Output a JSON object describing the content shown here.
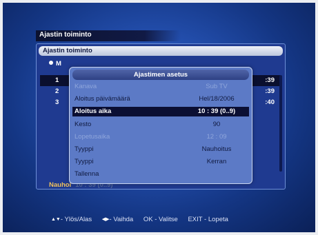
{
  "window": {
    "title": "Ajastin toiminto",
    "header": "Ajastin toiminto",
    "mode_text": "M"
  },
  "timers": [
    {
      "num": "1",
      "time": ":39",
      "selected": true
    },
    {
      "num": "2",
      "time": ":39",
      "selected": false
    },
    {
      "num": "3",
      "time": ":40",
      "selected": false
    }
  ],
  "status": {
    "text": "Nauhoi",
    "dim": "10 : 39 (0..9)"
  },
  "dialog": {
    "title": "Ajastimen asetus",
    "fields": [
      {
        "label": "Kanava",
        "value": "Sub TV",
        "state": "faded"
      },
      {
        "label": "Aloitus päivämäärä",
        "value": "Hel/18/2006",
        "state": "normal"
      },
      {
        "label": "Aloitus aika",
        "value": "10 : 39 (0..9)",
        "state": "selected"
      },
      {
        "label": "Kesto",
        "value": "90",
        "state": "normal"
      },
      {
        "label": "Lopetusaika",
        "value": "12 : 09",
        "state": "faded"
      },
      {
        "label": "Tyyppi",
        "value": "Nauhoitus",
        "state": "normal"
      },
      {
        "label": "Tyyppi",
        "value": "Kerran",
        "state": "normal"
      },
      {
        "label": "Tallenna",
        "value": "",
        "state": "normal"
      }
    ]
  },
  "help": {
    "updown": {
      "icon": "▲▼",
      "text": "- Ylös/Alas"
    },
    "change": {
      "icon": "◀▶",
      "text": "- Vaihda"
    },
    "ok": "OK - Valitse",
    "exit": "EXIT - Lopeta"
  },
  "icons": {
    "updown": "up-down-arrows-icon",
    "leftright": "left-right-arrows-icon"
  }
}
